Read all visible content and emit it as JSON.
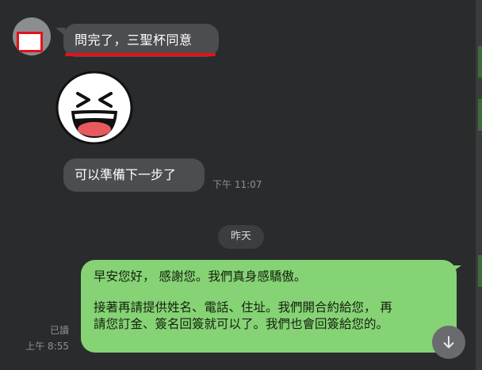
{
  "messages": {
    "incoming_1": "問完了，三聖杯同意",
    "incoming_2": "可以準備下一步了",
    "incoming_2_time": "下午 11:07",
    "date_separator": "昨天",
    "outgoing_line_1": "早安您好， 感謝您。我們真身感驕傲。",
    "outgoing_line_2": "接著再請提供姓名、電話、住址。我們開合約給您， 再",
    "outgoing_line_3": "請您訂金、簽名回簽就可以了。我們也會回簽給您的。",
    "outgoing_read": "已讀",
    "outgoing_time": "上午 8:55"
  },
  "icons": {
    "sticker": "laughing-face-sticker",
    "scroll_down": "arrow-down-icon"
  },
  "colors": {
    "background": "#2a2b2d",
    "incoming_bubble": "#4c4d50",
    "outgoing_bubble": "#85d375",
    "redaction": "#e3121a"
  }
}
